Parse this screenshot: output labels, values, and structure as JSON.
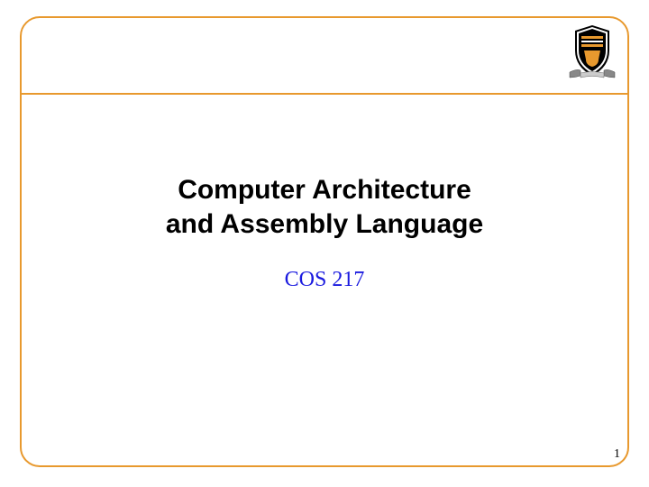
{
  "slide": {
    "title_line1": "Computer Architecture",
    "title_line2": "and Assembly Language",
    "subtitle": "COS 217",
    "page_number": "1"
  },
  "colors": {
    "border": "#e8992e",
    "subtitle": "#1a1adf"
  }
}
